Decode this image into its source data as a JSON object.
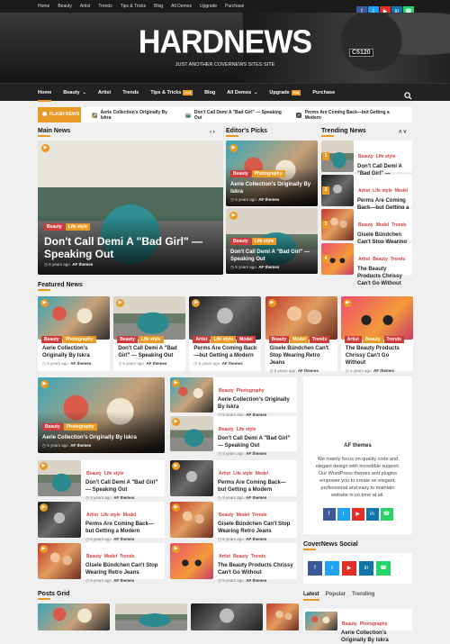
{
  "topbar": {
    "links": [
      "Home",
      "Beauty",
      "Artist",
      "Trends",
      "Tips & Tricks",
      "Blog",
      "All Demos",
      "Upgrade",
      "Purchase"
    ],
    "social": [
      {
        "icon": "facebook-icon",
        "glyph": "f",
        "color": "#3b5998"
      },
      {
        "icon": "twitter-icon",
        "glyph": "t",
        "color": "#1da1f2"
      },
      {
        "icon": "youtube-icon",
        "glyph": "▶",
        "color": "#e52d27"
      },
      {
        "icon": "linkedin-icon",
        "glyph": "in",
        "color": "#0e76a8"
      },
      {
        "icon": "whatsapp-icon",
        "glyph": "☎",
        "color": "#25d366"
      }
    ]
  },
  "header": {
    "logo": "HARDNEWS",
    "tagline": "JUST ANOTHER COVERNEWS SITES SITE",
    "train_plate": "C5120"
  },
  "nav": {
    "items": [
      {
        "label": "Home",
        "active": true
      },
      {
        "label": "Beauty",
        "dropdown": true
      },
      {
        "label": "Artist"
      },
      {
        "label": "Trends"
      },
      {
        "label": "Tips & Tricks",
        "badge": "Hot"
      },
      {
        "label": "Blog"
      },
      {
        "label": "All Demos",
        "dropdown": true
      },
      {
        "label": "Upgrade",
        "badge": "Hot"
      },
      {
        "label": "Purchase"
      }
    ],
    "search_icon": "search-icon"
  },
  "flash": {
    "label": "FLASH NEWS",
    "items": [
      "Aerie Collection's Originally By Iskra",
      "Don't Call Demi A \"Bad Girl\" — Speaking Out",
      "Perms Are Coming Back—but Getting a Modern"
    ]
  },
  "main_news": {
    "heading": "Main News",
    "cats": [
      "Beauty",
      "Life style"
    ],
    "title": "Don't Call Demi A \"Bad Girl\" — Speaking Out",
    "meta_time": "5 years ago",
    "meta_author": "AF themes"
  },
  "editors": {
    "heading": "Editor's Picks",
    "items": [
      {
        "cats": [
          "Beauty",
          "Photography"
        ],
        "title": "Aerie Collection's Originally By Iskra",
        "time": "5 years ago",
        "author": "AF themes"
      },
      {
        "cats": [
          "Beauty",
          "Life style"
        ],
        "title": "Don't Call Demi A \"Bad Girl\" — Speaking Out",
        "time": "5 years ago",
        "author": "AF themes"
      }
    ]
  },
  "trending": {
    "heading": "Trending News",
    "items": [
      {
        "num": "1",
        "cats": [
          "Beauty",
          "Life style"
        ],
        "title": "Don't Call Demi A \"Bad Girl\" — Speaking Out"
      },
      {
        "num": "2",
        "cats": [
          "Artist",
          "Life style",
          "Model"
        ],
        "title": "Perms Are Coming Back—but Getting a Modern"
      },
      {
        "num": "3",
        "cats": [
          "Beauty",
          "Model",
          "Trends"
        ],
        "title": "Gisele Bündchen Can't Stop Wearing Retro Jeans"
      },
      {
        "num": "4",
        "cats": [
          "Artist",
          "Beauty",
          "Trends"
        ],
        "title": "The Beauty Products Chrissy Can't Go Without"
      }
    ]
  },
  "featured": {
    "heading": "Featured News",
    "items": [
      {
        "cats": [
          "Beauty",
          "Photography"
        ],
        "title": "Aerie Collection's Originally By Iskra",
        "time": "5 years ago",
        "author": "AF themes"
      },
      {
        "cats": [
          "Beauty",
          "Life style"
        ],
        "title": "Don't Call Demi A \"Bad Girl\" — Speaking Out",
        "time": "5 years ago",
        "author": "AF themes"
      },
      {
        "cats": [
          "Artist",
          "Life style",
          "Model"
        ],
        "title": "Perms Are Coming Back—but Getting a Modern",
        "time": "5 years ago",
        "author": "AF themes"
      },
      {
        "cats": [
          "Beauty",
          "Model",
          "Trends"
        ],
        "title": "Gisele Bündchen Can't Stop Wearing Retro Jeans",
        "time": "5 years ago",
        "author": "AF themes"
      },
      {
        "cats": [
          "Artist",
          "Beauty",
          "Trends"
        ],
        "title": "The Beauty Products Chrissy Can't Go Without",
        "time": "5 years ago",
        "author": "AF themes"
      }
    ]
  },
  "grid_block": {
    "big": {
      "cats": [
        "Beauty",
        "Photography"
      ],
      "title": "Aerie Collection's Originally By Iskra",
      "time": "5 years ago",
      "author": "AF themes"
    },
    "right": [
      {
        "cats": [
          "Beauty",
          "Photography"
        ],
        "title": "Aerie Collection's Originally By Iskra",
        "time": "5 years ago",
        "author": "AF themes"
      },
      {
        "cats": [
          "Beauty",
          "Life style"
        ],
        "title": "Don't Call Demi A \"Bad Girl\" — Speaking Out",
        "time": "5 years ago",
        "author": "AF themes"
      }
    ],
    "list": [
      {
        "cats": [
          "Beauty",
          "Life style"
        ],
        "title": "Don't Call Demi A \"Bad Girl\" — Speaking Out",
        "time": "5 years ago",
        "author": "AF themes"
      },
      {
        "cats": [
          "Artist",
          "Life style",
          "Model"
        ],
        "title": "Perms Are Coming Back—but Getting a Modern",
        "time": "5 years ago",
        "author": "AF themes"
      },
      {
        "cats": [
          "Artist",
          "Life style",
          "Model"
        ],
        "title": "Perms Are Coming Back—but Getting a Modern",
        "time": "5 years ago",
        "author": "AF themes"
      },
      {
        "cats": [
          "Beauty",
          "Model",
          "Trends"
        ],
        "title": "Gisele Bündchen Can't Stop Wearing Retro Jeans",
        "time": "5 years ago",
        "author": "AF themes"
      },
      {
        "cats": [
          "Beauty",
          "Model",
          "Trends"
        ],
        "title": "Gisele Bündchen Can't Stop Wearing Retro Jeans",
        "time": "5 years ago",
        "author": "AF themes"
      },
      {
        "cats": [
          "Artist",
          "Beauty",
          "Trends"
        ],
        "title": "The Beauty Products Chrissy Can't Go Without",
        "time": "5 years ago",
        "author": "AF themes"
      }
    ]
  },
  "about": {
    "title": "AF themes",
    "text": "We mainly focus on quality code and elegant design with incredible support. Our WordPress themes and plugins empower you to create an elegant, professional and easy to maintain website in no time at all."
  },
  "social_widget": {
    "heading": "CoverNews Social"
  },
  "tabs": {
    "items": [
      "Latest",
      "Popular",
      "Trending"
    ],
    "first_item": {
      "cats": [
        "Beauty",
        "Photography"
      ],
      "title": "Aerie Collection's Originally By Iskra"
    }
  },
  "posts_grid": {
    "heading": "Posts Grid"
  }
}
